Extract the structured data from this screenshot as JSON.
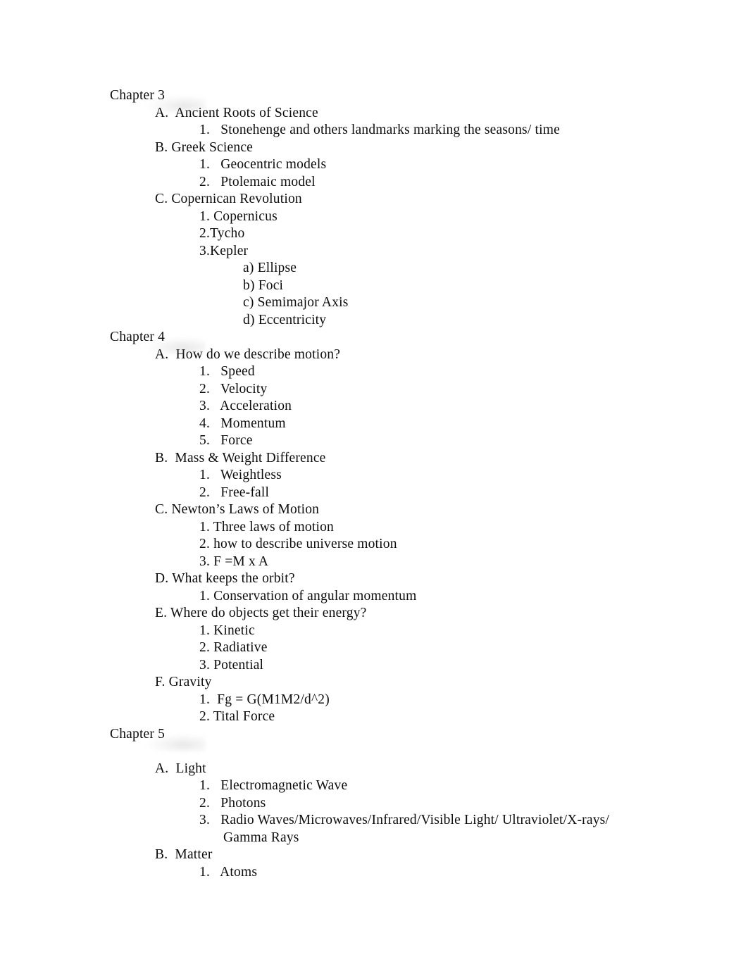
{
  "document": {
    "title": "Astronomy Course Outline — Chapters 3-5",
    "blocks": [
      {
        "level": "chapter",
        "text": "Chapter 3"
      },
      {
        "level": "letter",
        "text": "A.  Ancient Roots of Science"
      },
      {
        "level": "number",
        "text": "1.   Stonehenge and others landmarks marking the seasons/ time"
      },
      {
        "level": "letter",
        "text": "B. Greek Science"
      },
      {
        "level": "number",
        "text": "1.   Geocentric models"
      },
      {
        "level": "number",
        "text": "2.   Ptolemaic model"
      },
      {
        "level": "letter",
        "text": "C. Copernican Revolution"
      },
      {
        "level": "number",
        "text": "1. Copernicus"
      },
      {
        "level": "number",
        "text": "2.Tycho"
      },
      {
        "level": "number",
        "text": "3.Kepler"
      },
      {
        "level": "alpha",
        "text": "a) Ellipse"
      },
      {
        "level": "alpha",
        "text": "b) Foci"
      },
      {
        "level": "alpha",
        "text": "c) Semimajor Axis"
      },
      {
        "level": "alpha",
        "text": "d) Eccentricity"
      },
      {
        "level": "chapter",
        "text": "Chapter 4"
      },
      {
        "level": "letter",
        "text": "A.  How do we describe motion?"
      },
      {
        "level": "number",
        "text": "1.   Speed"
      },
      {
        "level": "number",
        "text": "2.   Velocity"
      },
      {
        "level": "number",
        "text": "3.   Acceleration"
      },
      {
        "level": "number",
        "text": "4.   Momentum"
      },
      {
        "level": "number",
        "text": "5.   Force"
      },
      {
        "level": "letter",
        "text": "B.  Mass & Weight Difference"
      },
      {
        "level": "number",
        "text": "1.   Weightless"
      },
      {
        "level": "number",
        "text": "2.   Free-fall"
      },
      {
        "level": "letter",
        "text": "C. Newton’s Laws of Motion"
      },
      {
        "level": "number",
        "text": "1. Three laws of motion"
      },
      {
        "level": "number",
        "text": "2. how to describe universe motion"
      },
      {
        "level": "number",
        "text": "3. F =M x A"
      },
      {
        "level": "letter",
        "text": "D. What keeps the orbit?"
      },
      {
        "level": "number",
        "text": "1. Conservation of angular momentum"
      },
      {
        "level": "letter",
        "text": "E. Where do objects get their energy?"
      },
      {
        "level": "number",
        "text": "1. Kinetic"
      },
      {
        "level": "number",
        "text": "2. Radiative"
      },
      {
        "level": "number",
        "text": "3. Potential"
      },
      {
        "level": "letter",
        "text": "F. Gravity"
      },
      {
        "level": "number",
        "text": "1.  Fg = G(M1M2/d^2)"
      },
      {
        "level": "number",
        "text": "2. Tital Force"
      },
      {
        "level": "chapter",
        "text": "Chapter 5"
      },
      {
        "level": "blank",
        "text": ""
      },
      {
        "level": "letter",
        "text": "A.  Light"
      },
      {
        "level": "number",
        "text": "1.   Electromagnetic Wave"
      },
      {
        "level": "number",
        "text": "2.   Photons"
      },
      {
        "level": "wrap-number",
        "text": "3.   Radio Waves/Microwaves/Infrared/Visible Light/ Ultraviolet/X-rays/ Gamma Rays"
      },
      {
        "level": "letter",
        "text": "B.  Matter"
      },
      {
        "level": "number",
        "text": "1.   Atoms"
      }
    ]
  },
  "style": {
    "background_color": "#ffffff",
    "text_color": "#0d0d0d"
  }
}
